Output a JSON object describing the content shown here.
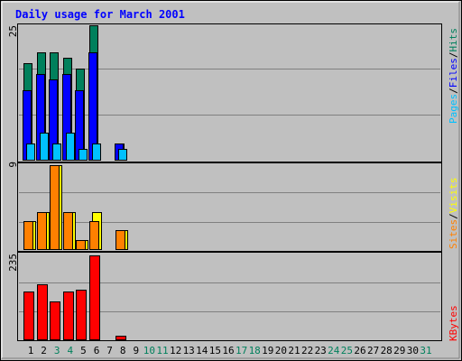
{
  "colors": {
    "background": "#c0c0c0",
    "title": "#0000ff",
    "hits": "#00805c",
    "files": "#0000ff",
    "pages": "#00c0ff",
    "visits": "#ffff00",
    "sites": "#ff8000",
    "kbytes": "#ff0000",
    "weekday_text": "#000000",
    "weekend_text": "#00805c",
    "gridline": "#808080"
  },
  "chart_data": {
    "type": "bar",
    "title": "Daily usage for March 2001",
    "days": [
      "1",
      "2",
      "3",
      "4",
      "5",
      "6",
      "7",
      "8",
      "9",
      "10",
      "11",
      "12",
      "13",
      "14",
      "15",
      "16",
      "17",
      "18",
      "19",
      "20",
      "21",
      "22",
      "23",
      "24",
      "25",
      "26",
      "27",
      "28",
      "29",
      "30",
      "31"
    ],
    "weekend_days": [
      "3",
      "4",
      "10",
      "11",
      "17",
      "18",
      "24",
      "25",
      "31"
    ],
    "panels": [
      {
        "id": "hits",
        "ymax": 25,
        "ymax_label": "25",
        "axis_label": [
          "Pages",
          "/",
          "Files",
          "/",
          "Hits"
        ],
        "series": [
          {
            "name": "Hits",
            "values": [
              18,
              20,
              20,
              19,
              17,
              25,
              0,
              3,
              0,
              0,
              0,
              0,
              0,
              0,
              0,
              0,
              0,
              0,
              0,
              0,
              0,
              0,
              0,
              0,
              0,
              0,
              0,
              0,
              0,
              0,
              0
            ]
          },
          {
            "name": "Files",
            "values": [
              13,
              16,
              15,
              16,
              13,
              20,
              0,
              3,
              0,
              0,
              0,
              0,
              0,
              0,
              0,
              0,
              0,
              0,
              0,
              0,
              0,
              0,
              0,
              0,
              0,
              0,
              0,
              0,
              0,
              0,
              0
            ]
          },
          {
            "name": "Pages",
            "values": [
              3,
              5,
              3,
              5,
              2,
              3,
              0,
              2,
              0,
              0,
              0,
              0,
              0,
              0,
              0,
              0,
              0,
              0,
              0,
              0,
              0,
              0,
              0,
              0,
              0,
              0,
              0,
              0,
              0,
              0,
              0
            ]
          }
        ]
      },
      {
        "id": "visits",
        "ymax": 9,
        "ymax_label": "9",
        "axis_label": [
          "Sites",
          "/",
          "Visits"
        ],
        "series": [
          {
            "name": "Visits",
            "values": [
              3,
              4,
              9,
              4,
              1,
              4,
              0,
              2,
              0,
              0,
              0,
              0,
              0,
              0,
              0,
              0,
              0,
              0,
              0,
              0,
              0,
              0,
              0,
              0,
              0,
              0,
              0,
              0,
              0,
              0,
              0
            ]
          },
          {
            "name": "Sites",
            "values": [
              3,
              4,
              9,
              4,
              1,
              3,
              0,
              2,
              0,
              0,
              0,
              0,
              0,
              0,
              0,
              0,
              0,
              0,
              0,
              0,
              0,
              0,
              0,
              0,
              0,
              0,
              0,
              0,
              0,
              0,
              0
            ]
          }
        ]
      },
      {
        "id": "kbytes",
        "ymax": 235,
        "ymax_label": "235",
        "axis_label": [
          "KBytes"
        ],
        "series": [
          {
            "name": "KBytes",
            "values": [
              133,
              155,
              107,
              135,
              140,
              235,
              0,
              10,
              0,
              0,
              0,
              0,
              0,
              0,
              0,
              0,
              0,
              0,
              0,
              0,
              0,
              0,
              0,
              0,
              0,
              0,
              0,
              0,
              0,
              0,
              0
            ]
          }
        ]
      }
    ]
  }
}
